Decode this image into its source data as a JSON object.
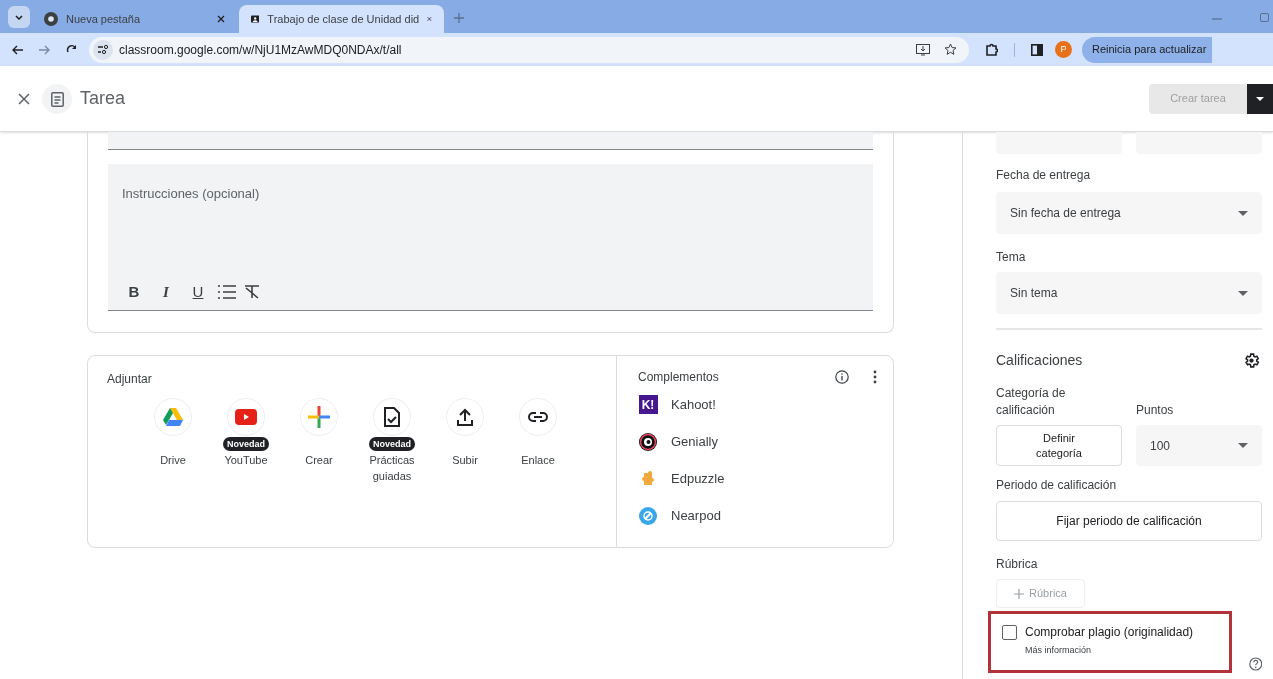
{
  "browser": {
    "tabs": [
      {
        "title": "Nueva pestaña",
        "kind": "newtab",
        "selected": false
      },
      {
        "title": "Trabajo de clase de Unidad did",
        "kind": "classroom",
        "selected": true
      }
    ],
    "address": "classroom.google.com/w/NjU1MzAwMDQ0NDAx/t/all",
    "avatar": "P",
    "update_button": "Reinicia para actualizar"
  },
  "header": {
    "title": "Tarea",
    "create_button": {
      "label": "Crear tarea",
      "disabled": true
    }
  },
  "editor": {
    "instructions_placeholder": "Instrucciones (opcional)",
    "format_tools": [
      {
        "kind": "bold",
        "label": "B"
      },
      {
        "kind": "italic",
        "label": "I"
      },
      {
        "kind": "underline",
        "label": "U"
      },
      {
        "kind": "list"
      },
      {
        "kind": "clear"
      }
    ]
  },
  "attach": {
    "title": "Adjuntar",
    "items": [
      {
        "kind": "drive",
        "label": "Drive"
      },
      {
        "kind": "youtube",
        "label": "YouTube",
        "badge": "Novedad"
      },
      {
        "kind": "create",
        "label": "Crear"
      },
      {
        "kind": "practice",
        "label": "Prácticas guiadas",
        "badge": "Novedad"
      },
      {
        "kind": "upload",
        "label": "Subir"
      },
      {
        "kind": "link",
        "label": "Enlace"
      }
    ]
  },
  "addons": {
    "title": "Complementos",
    "items": [
      {
        "kind": "kahoot",
        "name": "Kahoot!",
        "logo": "K!"
      },
      {
        "kind": "genially",
        "name": "Genially"
      },
      {
        "kind": "edpuzzle",
        "name": "Edpuzzle"
      },
      {
        "kind": "nearpod",
        "name": "Nearpod"
      }
    ]
  },
  "settings": {
    "due_label": "Fecha de entrega",
    "due_value": "Sin fecha de entrega",
    "topic_label": "Tema",
    "topic_value": "Sin tema",
    "grading_title": "Calificaciones",
    "category_label": "Categoría de calificación",
    "points_label": "Puntos",
    "category_button": "Definir categoría",
    "points_value": "100",
    "period_label": "Periodo de calificación",
    "period_button": "Fijar periodo de calificación",
    "rubric_label": "Rúbrica",
    "rubric_button": "Rúbrica",
    "plagiarism": {
      "label": "Comprobar plagio (originalidad)",
      "link": "Más información",
      "checked": false
    }
  }
}
